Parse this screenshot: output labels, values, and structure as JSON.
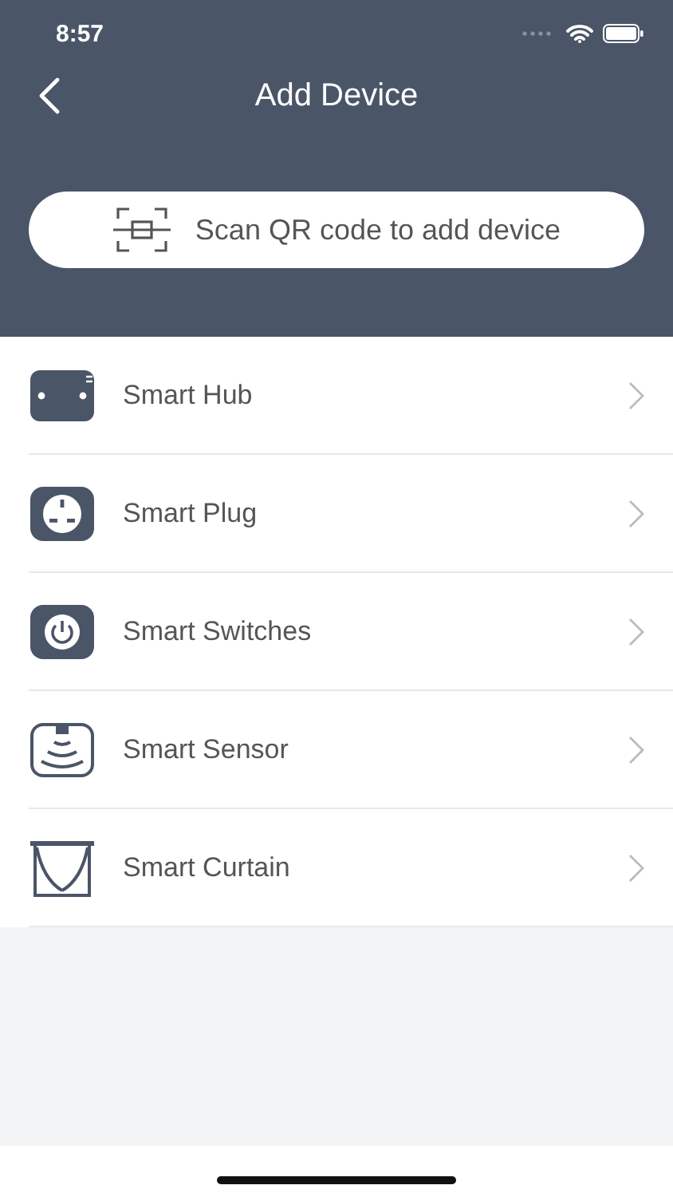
{
  "status_bar": {
    "time": "8:57"
  },
  "header": {
    "title": "Add Device"
  },
  "scan_button": {
    "label": "Scan QR code to add device"
  },
  "devices": [
    {
      "kind": "hub",
      "label": "Smart Hub"
    },
    {
      "kind": "plug",
      "label": "Smart Plug"
    },
    {
      "kind": "switch",
      "label": "Smart Switches"
    },
    {
      "kind": "sensor",
      "label": "Smart Sensor"
    },
    {
      "kind": "curtain",
      "label": "Smart Curtain"
    }
  ]
}
